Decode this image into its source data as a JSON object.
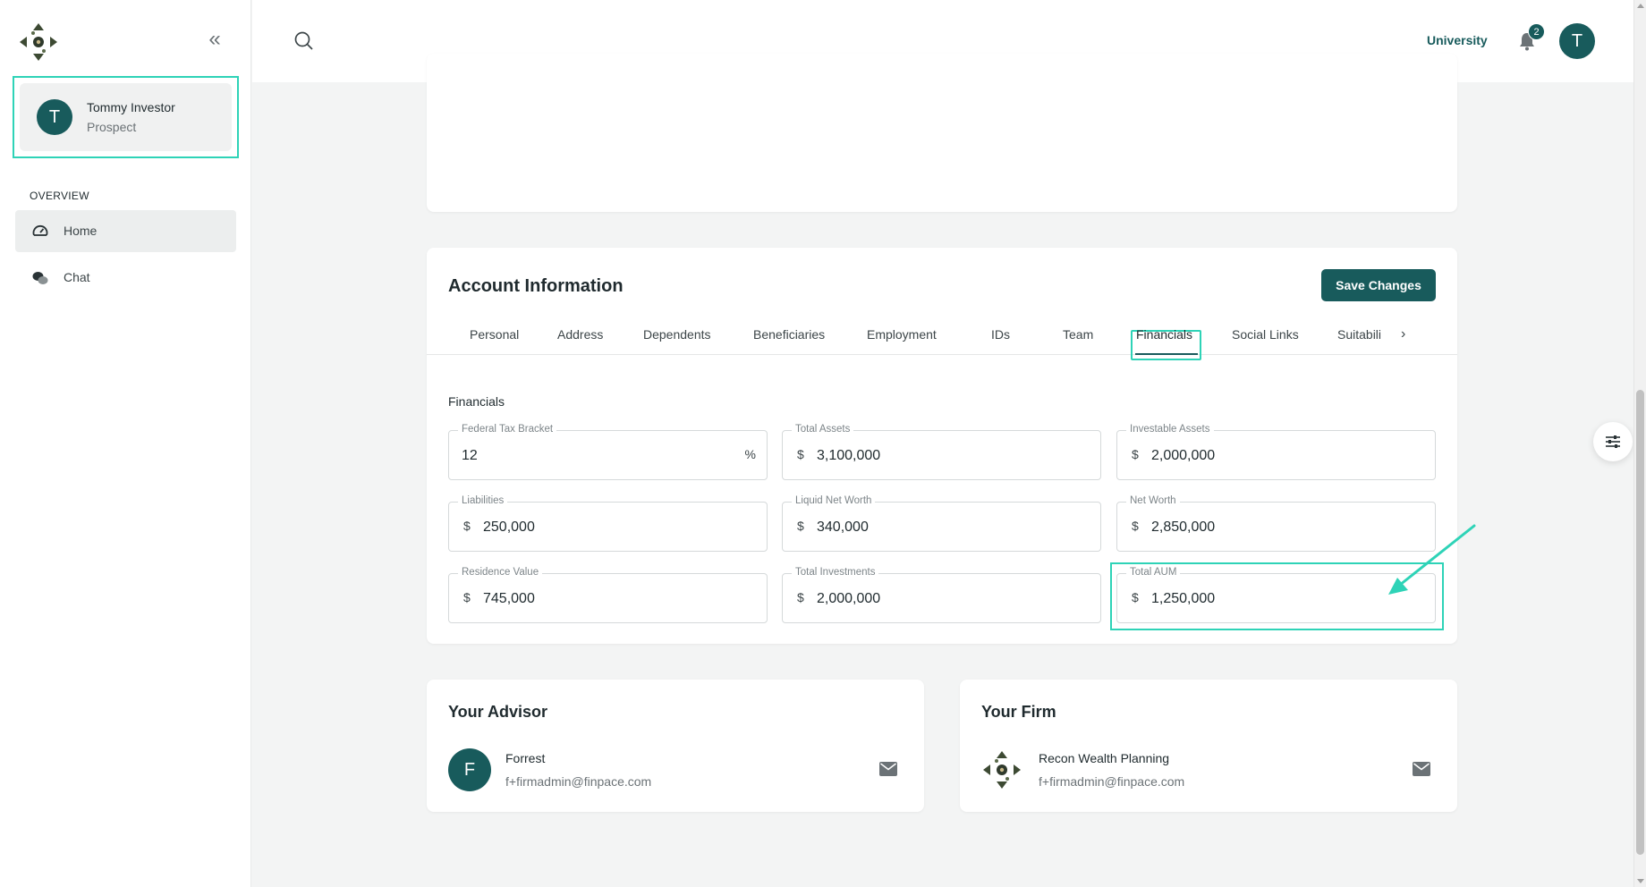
{
  "sidebar": {
    "logo_icon": "compass-arrows-logo",
    "user": {
      "initial": "T",
      "name": "Tommy Investor",
      "role": "Prospect"
    },
    "section_label": "OVERVIEW",
    "items": [
      {
        "label": "Home",
        "icon": "dashboard-gauge-icon",
        "active": true
      },
      {
        "label": "Chat",
        "icon": "chat-bubbles-icon",
        "active": false
      }
    ]
  },
  "topbar": {
    "university_label": "University",
    "notification_count": "2",
    "avatar_initial": "T"
  },
  "account": {
    "title": "Account Information",
    "save_label": "Save Changes",
    "tabs": [
      "Personal",
      "Address",
      "Dependents",
      "Beneficiaries",
      "Employment",
      "IDs",
      "Team",
      "Financials",
      "Social Links",
      "Suitabili"
    ],
    "active_tab": "Financials",
    "section_label": "Financials",
    "fields": {
      "federal_tax_bracket": {
        "label": "Federal Tax Bracket",
        "value": "12",
        "suffix": "%"
      },
      "total_assets": {
        "label": "Total Assets",
        "prefix": "$",
        "value": "3,100,000"
      },
      "investable_assets": {
        "label": "Investable Assets",
        "prefix": "$",
        "value": "2,000,000"
      },
      "liabilities": {
        "label": "Liabilities",
        "prefix": "$",
        "value": "250,000"
      },
      "liquid_net_worth": {
        "label": "Liquid Net Worth",
        "prefix": "$",
        "value": "340,000"
      },
      "net_worth": {
        "label": "Net Worth",
        "prefix": "$",
        "value": "2,850,000"
      },
      "residence_value": {
        "label": "Residence Value",
        "prefix": "$",
        "value": "745,000"
      },
      "total_investments": {
        "label": "Total Investments",
        "prefix": "$",
        "value": "2,000,000"
      },
      "total_aum": {
        "label": "Total AUM",
        "prefix": "$",
        "value": "1,250,000"
      }
    }
  },
  "advisor": {
    "title": "Your Advisor",
    "initial": "F",
    "name": "Forrest",
    "email": "f+firmadmin@finpace.com"
  },
  "firm": {
    "title": "Your Firm",
    "name": "Recon Wealth Planning",
    "email": "f+firmadmin@finpace.com"
  },
  "colors": {
    "brand": "#185b5c",
    "highlight": "#2ed3b7"
  }
}
